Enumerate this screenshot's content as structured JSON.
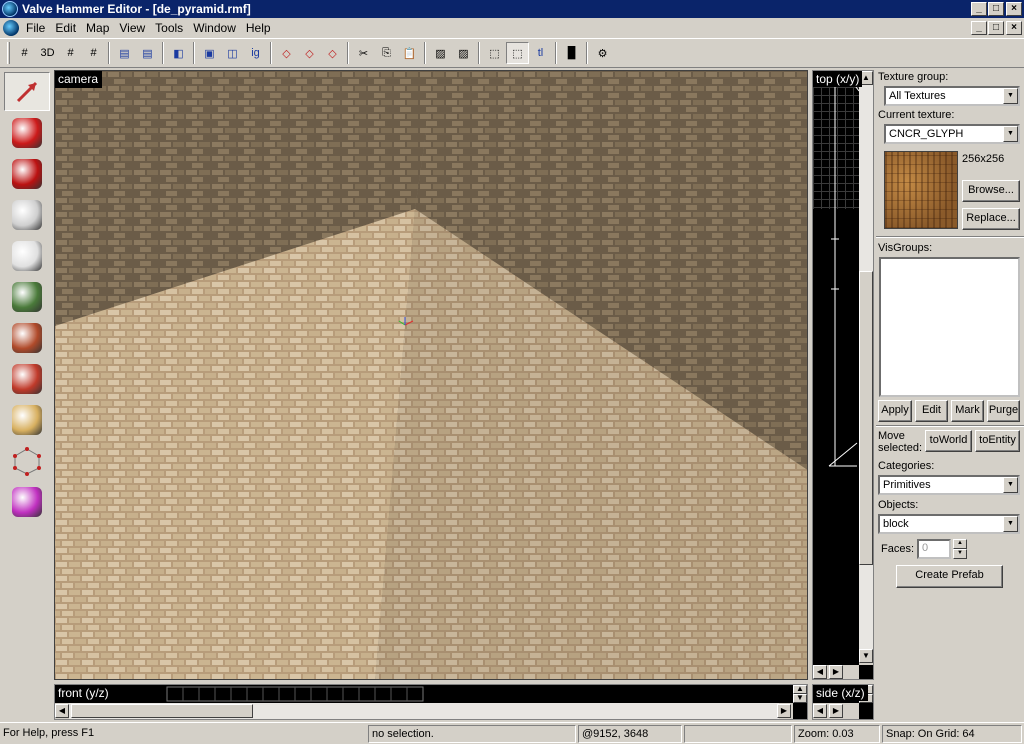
{
  "window": {
    "title": "Valve Hammer Editor - [de_pyramid.rmf]",
    "min": "_",
    "max": "□",
    "close": "×"
  },
  "menu": {
    "items": [
      "File",
      "Edit",
      "Map",
      "View",
      "Tools",
      "Window",
      "Help"
    ]
  },
  "toolbar": {
    "buttons": [
      {
        "name": "grid-toggle",
        "glyph": "#"
      },
      {
        "name": "3d-grid",
        "glyph": "3D"
      },
      {
        "name": "smaller-grid",
        "glyph": "#"
      },
      {
        "name": "larger-grid",
        "glyph": "#"
      },
      {
        "name": "sep"
      },
      {
        "name": "texture-lock",
        "glyph": "▤"
      },
      {
        "name": "texture-scale-lock",
        "glyph": "▤"
      },
      {
        "name": "sep"
      },
      {
        "name": "carve",
        "glyph": "◧"
      },
      {
        "name": "sep"
      },
      {
        "name": "group",
        "glyph": "▣"
      },
      {
        "name": "ungroup",
        "glyph": "◫"
      },
      {
        "name": "ignore-groups",
        "glyph": "ig"
      },
      {
        "name": "sep"
      },
      {
        "name": "hide-selection",
        "glyph": "◇"
      },
      {
        "name": "show-selection",
        "glyph": "◇"
      },
      {
        "name": "hide-unselected",
        "glyph": "◇"
      },
      {
        "name": "sep"
      },
      {
        "name": "cut",
        "glyph": "✂"
      },
      {
        "name": "copy",
        "glyph": "⎘"
      },
      {
        "name": "paste",
        "glyph": "📋"
      },
      {
        "name": "sep"
      },
      {
        "name": "toggle-texlock",
        "glyph": "▨"
      },
      {
        "name": "toggle-helpers",
        "glyph": "▨"
      },
      {
        "name": "sep"
      },
      {
        "name": "autosize",
        "glyph": "⬚"
      },
      {
        "name": "select-handles",
        "glyph": "⬚"
      },
      {
        "name": "texture-label",
        "glyph": "tl"
      },
      {
        "name": "sep"
      },
      {
        "name": "run-map",
        "glyph": "▐▌"
      },
      {
        "name": "sep"
      },
      {
        "name": "transform",
        "glyph": "⚙"
      }
    ]
  },
  "tools": [
    {
      "name": "selection-tool",
      "color": "#c03030",
      "active": true
    },
    {
      "name": "magnify-tool",
      "color": "#cc1a1a"
    },
    {
      "name": "camera-tool",
      "color": "#bb1111"
    },
    {
      "name": "entity-tool",
      "color": "#cfcfcf"
    },
    {
      "name": "block-tool",
      "color": "#e0e0e0"
    },
    {
      "name": "texture-application-tool",
      "color": "#4a7a3a"
    },
    {
      "name": "apply-current-texture-tool",
      "color": "#b04a2a"
    },
    {
      "name": "decal-tool",
      "color": "#c03a2a"
    },
    {
      "name": "clipping-tool",
      "color": "#d8b060"
    },
    {
      "name": "vertex-manipulation-tool",
      "color": "#c02020"
    },
    {
      "name": "path-tool",
      "color": "#c030c0"
    }
  ],
  "camera": {
    "label": "camera"
  },
  "views": {
    "top": "top (x/y)",
    "front": "front (y/z)",
    "side": "side (x/z)"
  },
  "panel": {
    "texture_group_label": "Texture group:",
    "texture_group_value": "All Textures",
    "current_texture_label": "Current texture:",
    "current_texture_value": "CNCR_GLYPH",
    "texture_size": "256x256",
    "browse": "Browse...",
    "replace": "Replace...",
    "visgroups_label": "VisGroups:",
    "apply": "Apply",
    "edit": "Edit",
    "mark": "Mark",
    "purge": "Purge",
    "move_selected_label": "Move selected:",
    "to_world": "toWorld",
    "to_entity": "toEntity",
    "categories_label": "Categories:",
    "categories_value": "Primitives",
    "objects_label": "Objects:",
    "objects_value": "block",
    "faces_label": "Faces:",
    "faces_value": "0",
    "create_prefab": "Create Prefab"
  },
  "status": {
    "help": "For Help, press F1",
    "selection": "no selection.",
    "coords": "@9152, 3648",
    "zoom": "Zoom: 0.03",
    "snap": "Snap: On Grid: 64"
  }
}
